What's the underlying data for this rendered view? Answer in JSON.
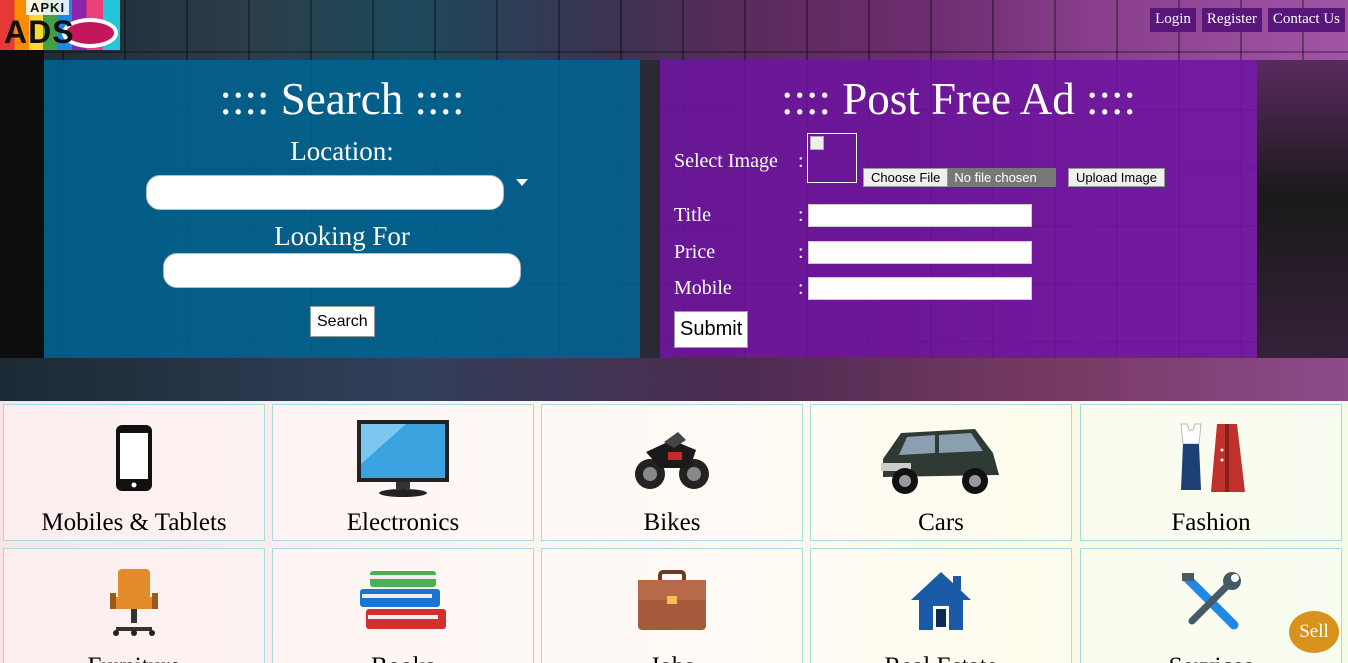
{
  "logo": {
    "small_text": "APKI",
    "big_text": "ADS"
  },
  "topnav": {
    "login": "Login",
    "register": "Register",
    "contact": "Contact Us"
  },
  "search": {
    "title": ":::: Search ::::",
    "location_label": "Location:",
    "location_value": "",
    "looking_label": "Looking For",
    "looking_value": "",
    "button": "Search"
  },
  "post": {
    "title": ":::: Post Free Ad ::::",
    "select_image_label": "Select Image",
    "choose_file_button": "Choose File",
    "no_file_text": "No file chosen",
    "upload_button": "Upload Image",
    "title_label": "Title",
    "price_label": "Price",
    "mobile_label": "Mobile",
    "colon": ":",
    "submit": "Submit"
  },
  "categories": [
    {
      "label": "Mobiles & Tablets",
      "icon": "mobile-icon"
    },
    {
      "label": "Electronics",
      "icon": "tv-icon"
    },
    {
      "label": "Bikes",
      "icon": "motorbike-icon"
    },
    {
      "label": "Cars",
      "icon": "car-icon"
    },
    {
      "label": "Fashion",
      "icon": "fashion-icon"
    },
    {
      "label": "Furniture",
      "icon": "chair-icon"
    },
    {
      "label": "Books",
      "icon": "books-icon"
    },
    {
      "label": "Jobs",
      "icon": "briefcase-icon"
    },
    {
      "label": "Real Estate",
      "icon": "house-icon"
    },
    {
      "label": "Services",
      "icon": "tools-icon"
    }
  ],
  "sell_button": "Sell",
  "colors": {
    "search_panel": "#006391",
    "post_panel": "#6e14a0",
    "nav_bg": "#58157a",
    "sell": "#d9921c"
  }
}
